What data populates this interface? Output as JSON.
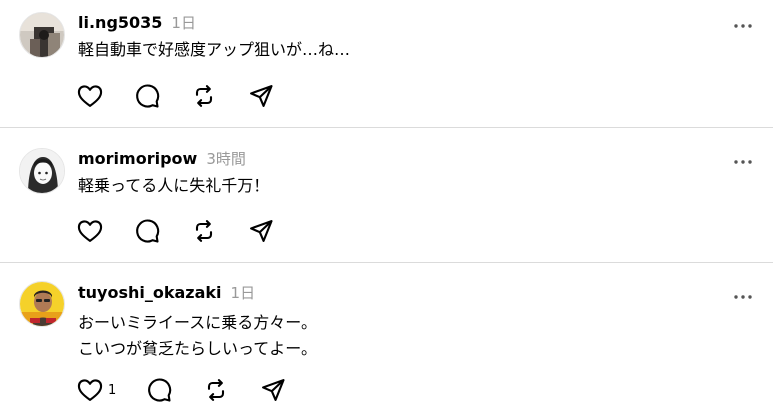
{
  "posts": [
    {
      "username": "li.ng5035",
      "time": "1日",
      "text": [
        "軽自動車で好感度アップ狙いが…ね…"
      ],
      "like_count": ""
    },
    {
      "username": "morimoripow",
      "time": "3時間",
      "text": [
        "軽乗ってる人に失礼千万！"
      ],
      "like_count": ""
    },
    {
      "username": "tuyoshi_okazaki",
      "time": "1日",
      "text": [
        "おーいミライースに乗る方々ー。",
        "こいつが貧乏たらしいってよー。"
      ],
      "like_count": "1"
    }
  ],
  "icons": {
    "like": "heart-icon",
    "comment": "comment-icon",
    "repost": "repost-icon",
    "share": "share-icon",
    "more": "more-icon"
  },
  "colors": {
    "meta_gray": "#999999",
    "divider": "#dbdbdb",
    "text": "#000000"
  }
}
